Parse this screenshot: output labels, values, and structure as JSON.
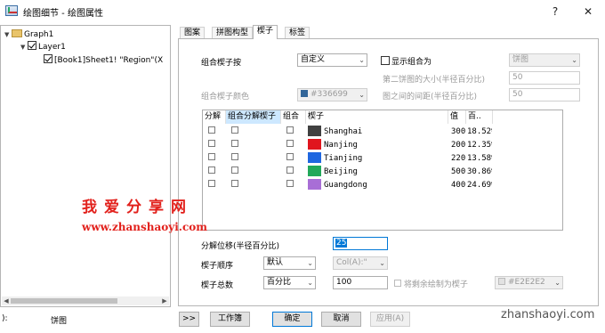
{
  "window": {
    "title": "绘图细节 - 绘图属性",
    "help_label": "?",
    "close_label": "✕"
  },
  "tree": {
    "items": [
      {
        "label": "Graph1",
        "checked": true
      },
      {
        "label": "Layer1",
        "checked": true
      },
      {
        "label": "[Book1]Sheet1! \"Region\"(X",
        "checked": true
      }
    ]
  },
  "status": {
    "left_label": "):",
    "plot_type": "饼图"
  },
  "tabs": [
    {
      "label": "图案",
      "active": false
    },
    {
      "label": "拼图构型",
      "active": false
    },
    {
      "label": "楔子",
      "active": true
    },
    {
      "label": "标签",
      "active": false
    }
  ],
  "wedge_settings": {
    "combine_by_label": "组合楔子按",
    "combine_by_value": "自定义",
    "show_combined_label": "显示组合为",
    "show_combined_value": "饼图",
    "second_pie_size_label": "第二饼图的大小(半径百分比)",
    "second_pie_size_value": "50",
    "gap_label": "图之间的间距(半径百分比)",
    "gap_value": "50",
    "combined_color_label": "组合楔子颜色",
    "combined_color_value": "#336699",
    "combined_color_hex": "#336699"
  },
  "grid": {
    "headers": [
      "分解",
      "组合分解楔子",
      "组合",
      "楔子",
      "值",
      "百.."
    ],
    "rows": [
      {
        "name": "Shanghai",
        "color": "#404040",
        "value": "300",
        "percent": "18.52%"
      },
      {
        "name": "Nanjing",
        "color": "#e0151e",
        "value": "200",
        "percent": "12.35%"
      },
      {
        "name": "Tianjing",
        "color": "#1f67e0",
        "value": "220",
        "percent": "13.58%"
      },
      {
        "name": "Beijing",
        "color": "#22a85a",
        "value": "500",
        "percent": "30.86%"
      },
      {
        "name": "Guangdong",
        "color": "#a86ed6",
        "value": "400",
        "percent": "24.69%"
      }
    ]
  },
  "bottom_settings": {
    "explode_offset_label": "分解位移(半径百分比)",
    "explode_offset_value": "25",
    "wedge_order_label": "楔子顺序",
    "wedge_order_value": "默认",
    "wedge_order_col": "Col(A):\"",
    "wedge_total_label": "楔子总数",
    "wedge_total_mode": "百分比",
    "wedge_total_value": "100",
    "draw_remaining_label": "将剩余绘制为楔子",
    "remaining_color_value": "#E2E2E2"
  },
  "watermarks": {
    "cn": "我爱分享网",
    "en": "www.zhanshaoyi.com",
    "corner": "zhanshaoyi.com"
  },
  "buttons": {
    "expand": ">>",
    "workbook": "工作簿",
    "ok": "确定",
    "cancel": "取消",
    "apply": "应用(A)"
  }
}
